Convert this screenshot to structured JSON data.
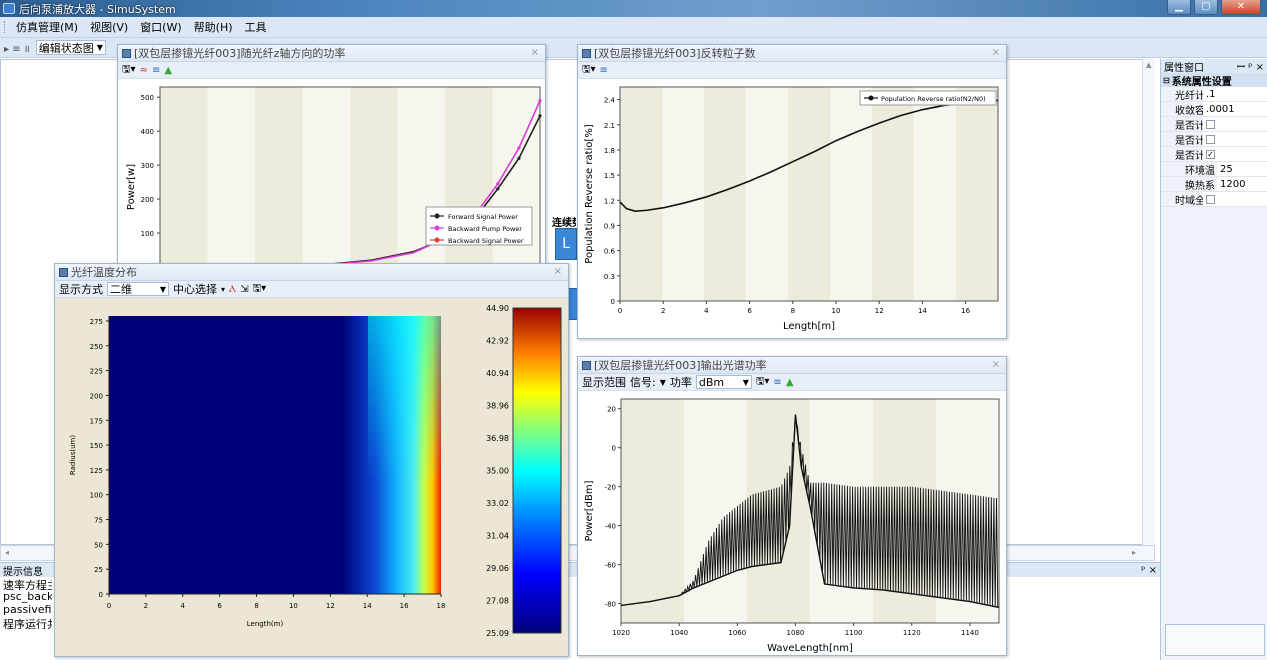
{
  "window": {
    "title": "后向泵浦放大器 - SimuSystem",
    "min_label": "▁",
    "max_label": "▢",
    "close_label": "✕"
  },
  "menu": [
    "仿真管理(M)",
    "视图(V)",
    "窗口(W)",
    "帮助(H)",
    "工具"
  ],
  "toolbar": {
    "symbols": "▸ ≡ ॥",
    "state_label": "编辑状态图"
  },
  "property_panel": {
    "title": "属性窗口",
    "pin": "ꟷ ᵖ ×",
    "section": "系统属性设置",
    "rows": [
      {
        "key": "光纤计算",
        "value": ".1",
        "checkbox": false
      },
      {
        "key": "收敛容忍",
        "value": ".0001",
        "checkbox": false
      },
      {
        "key": "是否计算",
        "value": "",
        "checkbox": true,
        "checked": false
      },
      {
        "key": "是否计算",
        "value": "",
        "checkbox": true,
        "checked": false
      },
      {
        "key": "是否计算",
        "value": "",
        "checkbox": true,
        "checked": true
      },
      {
        "key": "环境温",
        "value": "25",
        "checkbox": false,
        "sub": true
      },
      {
        "key": "换热系",
        "value": "1200",
        "checkbox": false,
        "sub": true
      },
      {
        "key": "时域全局",
        "value": "",
        "checkbox": true,
        "checked": false
      }
    ]
  },
  "messages": {
    "title": "提示信息",
    "lines": [
      "速率方程主",
      "psc_backw",
      "passivefibe",
      "程序运行共"
    ]
  },
  "behind_labels": {
    "lianxu": "连续势",
    "tu": "L"
  },
  "panes": {
    "power_z": {
      "title": "[双包层掺镱光纤003]随光纤z轴方向的功率",
      "close": "×",
      "chart_data": {
        "type": "line",
        "ylabel": "Power[w]",
        "yticks": [
          100,
          200,
          300,
          400,
          500
        ],
        "ylim": [
          0,
          530
        ],
        "xlim": [
          0,
          18
        ],
        "legend_position": "right",
        "series": [
          {
            "name": "Forward Signal Power",
            "color": "#222222",
            "x": [
              0,
              4,
              8,
              10,
              12,
              14,
              15,
              16,
              17,
              18
            ],
            "y": [
              0,
              2,
              8,
              20,
              45,
              95,
              150,
              230,
              320,
              445
            ]
          },
          {
            "name": "Backward Pump Power",
            "color": "#d93ad9",
            "x": [
              0,
              4,
              8,
              10,
              12,
              14,
              15,
              16,
              17,
              18
            ],
            "y": [
              0,
              2,
              7,
              18,
              42,
              98,
              160,
              245,
              350,
              490
            ]
          },
          {
            "name": "Backward Signal Power",
            "color": "#e03a3a",
            "x": [
              0,
              18
            ],
            "y": [
              0,
              0
            ]
          }
        ]
      }
    },
    "reverse": {
      "title": "[双包层掺镱光纤003]反转粒子数",
      "close": "×",
      "chart_data": {
        "type": "line",
        "xlabel": "Length[m]",
        "ylabel": "Population Reverse ratio[%]",
        "xticks": [
          0,
          2,
          4,
          6,
          8,
          10,
          12,
          14,
          16
        ],
        "yticks": [
          0,
          0.3,
          0.6,
          0.9,
          1.2,
          1.5,
          1.8,
          2.1,
          2.4
        ],
        "xlim": [
          0,
          17.5
        ],
        "ylim": [
          0,
          2.55
        ],
        "legend_position": "top-right",
        "series": [
          {
            "name": "Population  Reverse ratio(N2/N0)",
            "x": [
              0,
              0.3,
              0.7,
              1.2,
              2,
              3,
              4,
              5,
              6,
              7,
              8,
              9,
              10,
              11,
              12,
              13,
              14,
              15,
              16,
              17,
              17.5
            ],
            "y": [
              1.18,
              1.1,
              1.07,
              1.08,
              1.11,
              1.17,
              1.24,
              1.33,
              1.43,
              1.54,
              1.66,
              1.78,
              1.91,
              2.02,
              2.12,
              2.21,
              2.28,
              2.33,
              2.36,
              2.38,
              2.39
            ]
          }
        ]
      }
    },
    "temperature": {
      "title": "光纤温度分布",
      "close": "×",
      "display_label": "显示方式",
      "display_value": "二维",
      "center_label": "中心选择",
      "chart_data": {
        "type": "heatmap",
        "xlabel": "Length(m)",
        "ylabel": "Radius(um)",
        "xticks": [
          0,
          2,
          4,
          6,
          8,
          10,
          12,
          14,
          16,
          18
        ],
        "yticks": [
          0,
          25,
          50,
          75,
          100,
          125,
          150,
          175,
          200,
          225,
          250,
          275
        ],
        "xlim": [
          0,
          18
        ],
        "ylim": [
          0,
          280
        ],
        "colorbar_ticks": [
          "44.90",
          "42.92",
          "40.94",
          "38.96",
          "36.98",
          "35.00",
          "33.02",
          "31.04",
          "29.06",
          "27.08",
          "25.09"
        ],
        "value_range": [
          25.09,
          44.9
        ]
      }
    },
    "spectrum": {
      "title": "[双包层掺镱光纤003]输出光谱功率",
      "close": "×",
      "range_label": "显示范围",
      "signal_label": "信号:",
      "power_label": "功率",
      "unit_value": "dBm",
      "chart_data": {
        "type": "line",
        "xlabel": "WaveLength[nm]",
        "ylabel": "Power[dBm]",
        "xticks": [
          1020,
          1040,
          1060,
          1080,
          1100,
          1120,
          1140
        ],
        "yticks": [
          -80,
          -60,
          -40,
          -20,
          0,
          20
        ],
        "xlim": [
          1020,
          1150
        ],
        "ylim": [
          -90,
          25
        ],
        "series": [
          {
            "name": "",
            "x": [
              1020,
              1030,
              1040,
              1045,
              1050,
              1055,
              1060,
              1065,
              1070,
              1075,
              1078,
              1080,
              1082,
              1085,
              1090,
              1100,
              1110,
              1120,
              1130,
              1140,
              1150
            ],
            "floor": [
              -81,
              -79,
              -76,
              -72,
              -69,
              -66,
              -63,
              -61,
              -60,
              -59,
              -40,
              17,
              -10,
              -30,
              -70,
              -72,
              -73,
              -75,
              -77,
              -79,
              -82
            ],
            "peak": [
              -81,
              -79,
              -76,
              -68,
              -48,
              -36,
              -30,
              -24,
              -22,
              -20,
              -10,
              17,
              0,
              -18,
              -18,
              -20,
              -20,
              -20,
              -22,
              -24,
              -26
            ]
          }
        ]
      }
    }
  }
}
